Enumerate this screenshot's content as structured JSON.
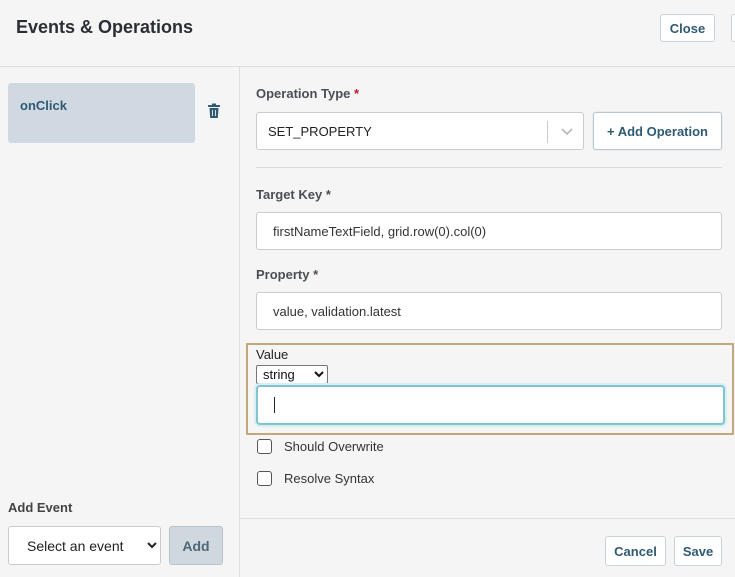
{
  "header": {
    "title": "Events & Operations",
    "close_label": "Close"
  },
  "events": {
    "items": [
      {
        "label": "onClick",
        "selected": true
      }
    ],
    "add_event_label": "Add Event",
    "event_select": {
      "selected": "Select an event"
    },
    "add_label": "Add"
  },
  "operation": {
    "type_label": "Operation Type",
    "required_mark": "*",
    "type_value": "SET_PROPERTY",
    "add_operation_label": "+ Add Operation",
    "target_key_label": "Target Key *",
    "target_key_value": "firstNameTextField, grid.row(0).col(0)",
    "property_label": "Property *",
    "property_value": "value, validation.latest",
    "value_label": "Value",
    "value_type": "string",
    "value_input": "",
    "should_overwrite_label": "Should Overwrite",
    "should_overwrite_checked": false,
    "resolve_syntax_label": "Resolve Syntax",
    "resolve_syntax_checked": false
  },
  "footer": {
    "cancel_label": "Cancel",
    "save_label": "Save"
  },
  "colors": {
    "accent": "#2f5a73",
    "selected_event_bg": "#d0d9e1",
    "required": "#c0182b",
    "focus_outline": "#c1a87a",
    "input_focus": "#7ec4d1"
  },
  "icons": {
    "delete_event": "trash-icon",
    "dropdown": "chevron-down-icon"
  }
}
